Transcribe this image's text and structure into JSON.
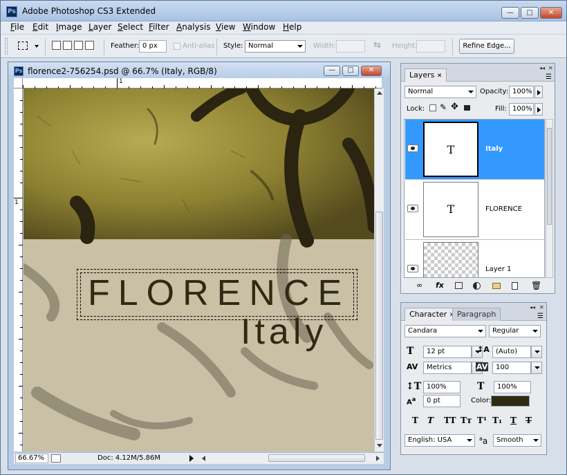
{
  "app": {
    "title": "Adobe Photoshop CS3 Extended",
    "icon_label": "Ps"
  },
  "menu": [
    "File",
    "Edit",
    "Image",
    "Layer",
    "Select",
    "Filter",
    "Analysis",
    "View",
    "Window",
    "Help"
  ],
  "options": {
    "feather_label": "Feather:",
    "feather_value": "0 px",
    "antialias_label": "Anti-alias",
    "style_label": "Style:",
    "style_value": "Normal",
    "width_label": "Width:",
    "height_label": "Height:",
    "refine_edge_label": "Refine Edge..."
  },
  "document": {
    "title": "florence2-756254.psd @ 66.7% (Italy, RGB/8)",
    "ruler_top_mark": "1",
    "ruler_left_mark": "1",
    "headline": "FLORENCE",
    "subhead": "Italy",
    "zoom": "66.67%",
    "doc_size": "Doc: 4.12M/5.86M"
  },
  "layers_panel": {
    "tab": "Layers",
    "blend_mode": "Normal",
    "opacity_label": "Opacity:",
    "opacity_value": "100%",
    "lock_label": "Lock:",
    "fill_label": "Fill:",
    "fill_value": "100%",
    "layers": [
      {
        "name": "Italy",
        "thumb": "T",
        "selected": true
      },
      {
        "name": "FLORENCE",
        "thumb": "T",
        "selected": false
      },
      {
        "name": "Layer 1",
        "thumb": "",
        "selected": false
      }
    ]
  },
  "character_panel": {
    "tab_active": "Character",
    "tab_inactive": "Paragraph",
    "font_family": "Candara",
    "font_style": "Regular",
    "font_size": "12 pt",
    "leading": "(Auto)",
    "kerning": "Metrics",
    "tracking": "100",
    "vertical_scale": "100%",
    "horizontal_scale": "100%",
    "baseline_shift": "0 pt",
    "color_label": "Color:",
    "text_color": "#2e2a14",
    "language": "English: USA",
    "antialias": "Smooth",
    "format_buttons": [
      "T",
      "T",
      "TT",
      "Tт",
      "T¹",
      "T₁",
      "T",
      "T"
    ]
  },
  "colors": {
    "selection_blue": "#3399ff",
    "text_dark": "#2e2a14"
  }
}
